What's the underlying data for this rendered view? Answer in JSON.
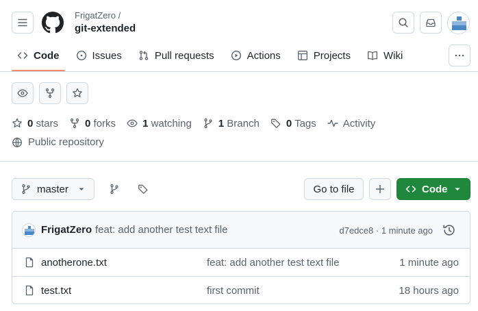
{
  "header": {
    "owner": "FrigatZero /",
    "repo": "git-extended"
  },
  "tabs": [
    {
      "label": "Code",
      "icon": "code-icon"
    },
    {
      "label": "Issues",
      "icon": "issue-icon"
    },
    {
      "label": "Pull requests",
      "icon": "pull-request-icon"
    },
    {
      "label": "Actions",
      "icon": "play-icon"
    },
    {
      "label": "Projects",
      "icon": "table-icon"
    },
    {
      "label": "Wiki",
      "icon": "book-icon"
    }
  ],
  "stats": {
    "stars_count": "0",
    "stars_label": "stars",
    "forks_count": "0",
    "forks_label": "forks",
    "watching_count": "1",
    "watching_label": "watching",
    "branch_count": "1",
    "branch_label": "Branch",
    "tags_count": "0",
    "tags_label": "Tags",
    "activity_label": "Activity",
    "visibility": "Public repository"
  },
  "toolbar": {
    "branch": "master",
    "goto_file": "Go to file",
    "code": "Code"
  },
  "commit": {
    "author": "FrigatZero",
    "message": "feat: add another test text file",
    "meta": "d7edce8 · 1 minute ago"
  },
  "files": [
    {
      "name": "anotherone.txt",
      "message": "feat: add another test text file",
      "time": "1 minute ago"
    },
    {
      "name": "test.txt",
      "message": "first commit",
      "time": "18 hours ago"
    }
  ],
  "colors": {
    "accent_underline": "#fd8c73",
    "code_button": "#1f883d",
    "border": "#d1d9e0",
    "muted_text": "#59636e"
  }
}
